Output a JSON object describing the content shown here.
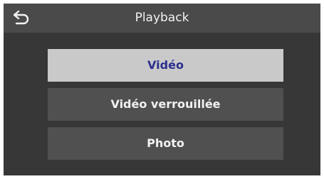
{
  "header": {
    "title": "Playback",
    "back_icon": "back-arrow-icon"
  },
  "menu": {
    "items": [
      {
        "label": "Vidéo",
        "selected": true
      },
      {
        "label": "Vidéo verrouillée",
        "selected": false
      },
      {
        "label": "Photo",
        "selected": false
      }
    ]
  },
  "colors": {
    "background": "#373737",
    "header": "#4a4a4a",
    "item": "#505050",
    "selected_item": "#c9c9c9",
    "selected_text": "#2b2f8e",
    "text": "#f2f2f2"
  }
}
